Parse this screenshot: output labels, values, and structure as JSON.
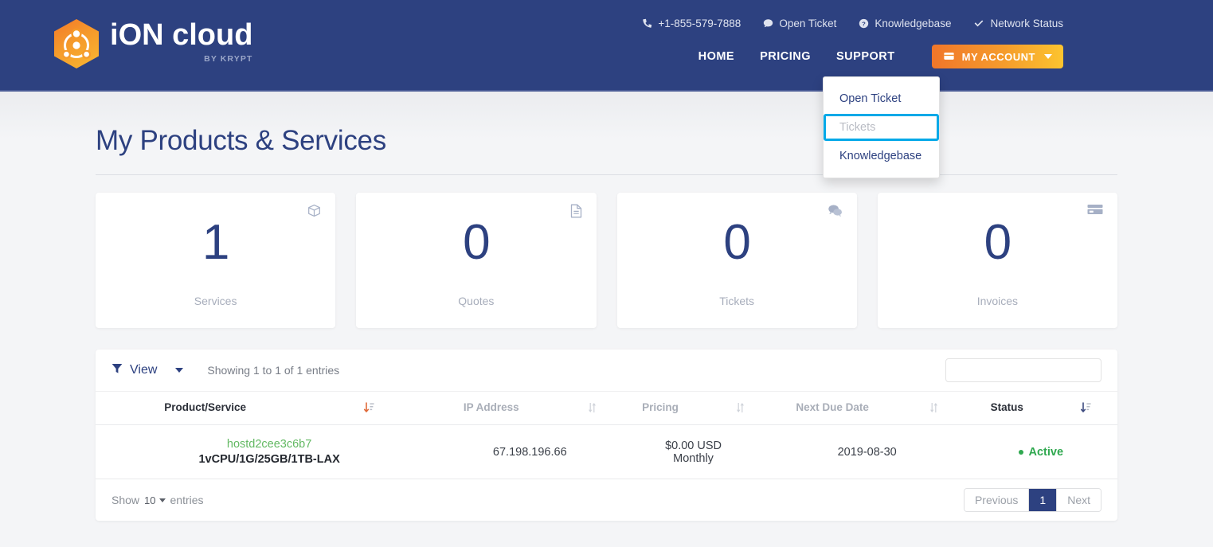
{
  "brand": {
    "name_i": "i",
    "name": "ON cloud",
    "tagline": "BY KRYPT",
    "logo_icon": "ion-atom-hexagon-logo",
    "hex_gradient_from": "#f3792a",
    "hex_gradient_to": "#f9b832"
  },
  "header": {
    "bg_color": "#2d4180",
    "top_links": [
      {
        "label": "+1-855-579-7888",
        "icon": "phone-icon"
      },
      {
        "label": "Open Ticket",
        "icon": "comment-icon"
      },
      {
        "label": "Knowledgebase",
        "icon": "question-circle-icon"
      },
      {
        "label": "Network Status",
        "icon": "check-icon"
      }
    ],
    "nav": [
      {
        "label": "HOME"
      },
      {
        "label": "PRICING"
      },
      {
        "label": "SUPPORT"
      }
    ],
    "account_button": {
      "label": "MY ACCOUNT",
      "icon": "briefcase-icon",
      "caret": "caret-down-icon",
      "gradient_from": "#f0762a",
      "gradient_to": "#fcc42f"
    }
  },
  "dropdown": {
    "items": [
      {
        "label": "Open Ticket",
        "focused": false
      },
      {
        "label": "Tickets",
        "focused": true
      },
      {
        "label": "Knowledgebase",
        "focused": false
      }
    ],
    "focus_outline_color": "#00a9e8"
  },
  "main": {
    "page_title": "My Products & Services",
    "stats": [
      {
        "value": "1",
        "label": "Services",
        "icon": "box-icon"
      },
      {
        "value": "0",
        "label": "Quotes",
        "icon": "file-icon"
      },
      {
        "value": "0",
        "label": "Tickets",
        "icon": "comments-icon"
      },
      {
        "value": "0",
        "label": "Invoices",
        "icon": "credit-card-icon"
      }
    ],
    "toolbar": {
      "view_label": "View",
      "view_icon": "filter-icon",
      "showing_text": "Showing 1 to 1 of 1 entries",
      "search_value": "",
      "search_placeholder": ""
    },
    "table": {
      "columns": [
        {
          "label": "Product/Service",
          "sort": "sort-amount-down-icon",
          "active": true
        },
        {
          "label": "IP Address",
          "sort": "sort-icon",
          "active": false
        },
        {
          "label": "Pricing",
          "sort": "sort-icon",
          "active": false
        },
        {
          "label": "Next Due Date",
          "sort": "sort-icon",
          "active": false
        },
        {
          "label": "Status",
          "sort": "sort-amount-down-icon",
          "active": true
        }
      ],
      "rows": [
        {
          "service_name": "hostd2cee3c6b7",
          "service_spec": "1vCPU/1G/25GB/1TB-LAX",
          "ip_address": "67.198.196.66",
          "price": "$0.00 USD",
          "billing_cycle": "Monthly",
          "next_due_date": "2019-08-30",
          "status": "Active",
          "status_color": "#2fa84f"
        }
      ]
    },
    "footer": {
      "show_label": "Show",
      "entries_value": "10",
      "entries_label": "entries",
      "pagination": {
        "previous": "Previous",
        "current_page": "1",
        "next": "Next"
      }
    }
  }
}
